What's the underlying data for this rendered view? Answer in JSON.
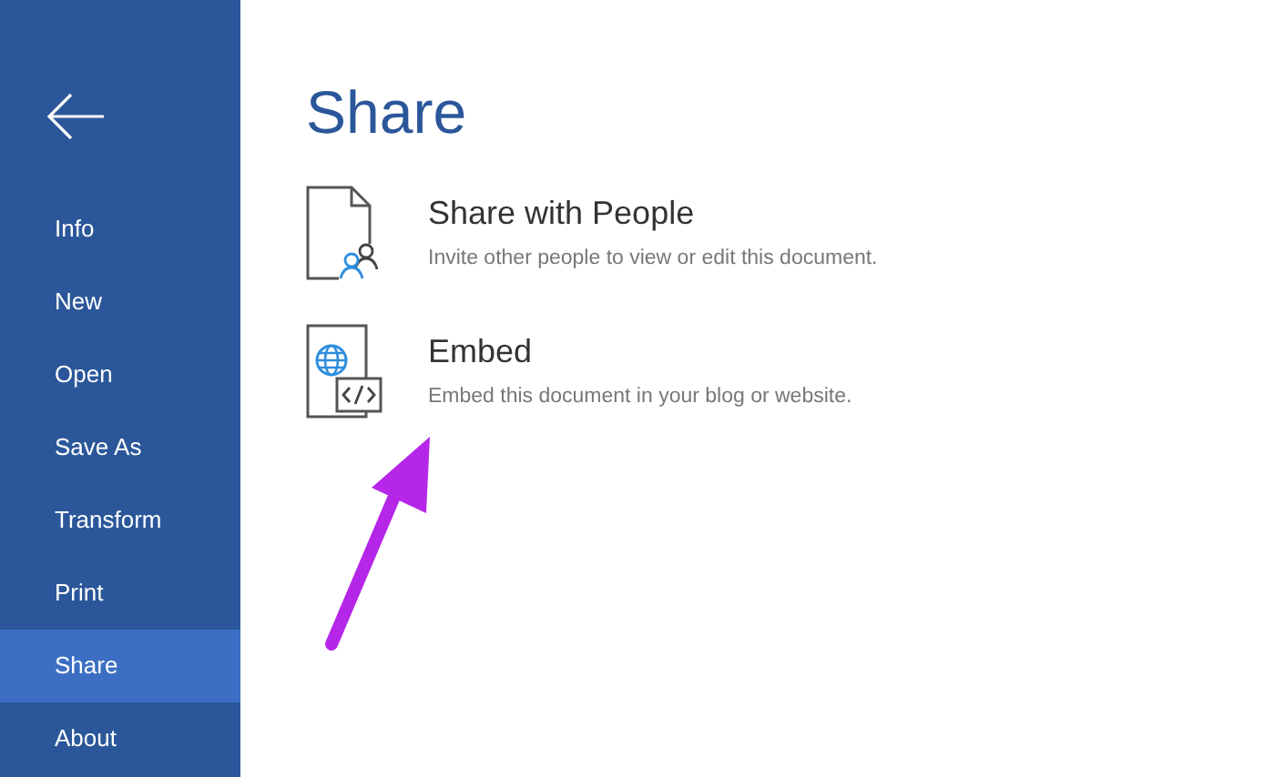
{
  "sidebar": {
    "items": [
      {
        "label": "Info",
        "selected": false
      },
      {
        "label": "New",
        "selected": false
      },
      {
        "label": "Open",
        "selected": false
      },
      {
        "label": "Save As",
        "selected": false
      },
      {
        "label": "Transform",
        "selected": false
      },
      {
        "label": "Print",
        "selected": false
      },
      {
        "label": "Share",
        "selected": true
      },
      {
        "label": "About",
        "selected": false
      }
    ]
  },
  "page": {
    "title": "Share",
    "options": [
      {
        "kind": "people",
        "title": "Share with People",
        "description": "Invite other people to view or edit this document."
      },
      {
        "kind": "embed",
        "title": "Embed",
        "description": "Embed this document in your blog or website."
      }
    ]
  }
}
